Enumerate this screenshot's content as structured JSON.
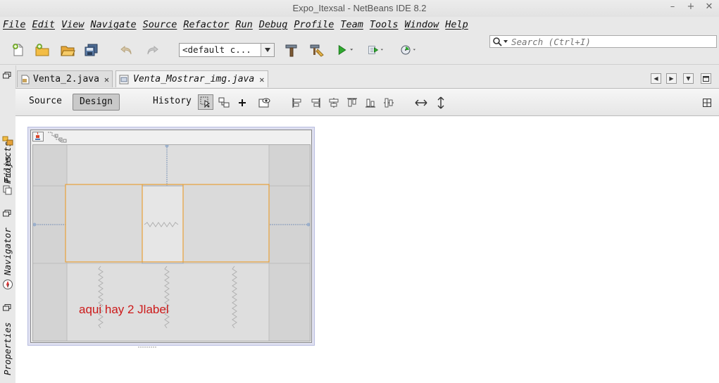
{
  "window": {
    "title": "Expo_Itexsal - NetBeans IDE 8.2",
    "controls": [
      "–",
      "+",
      "✕"
    ]
  },
  "menu": [
    "File",
    "Edit",
    "View",
    "Navigate",
    "Source",
    "Refactor",
    "Run",
    "Debug",
    "Profile",
    "Team",
    "Tools",
    "Window",
    "Help"
  ],
  "search": {
    "placeholder": "Search (Ctrl+I)"
  },
  "toolbar": {
    "config_combo": "<default c...",
    "icons": [
      "new-file-icon",
      "new-project-icon",
      "open-project-icon",
      "save-all-icon",
      "undo-icon",
      "redo-icon",
      "build-hammer-icon",
      "clean-build-icon",
      "run-icon",
      "debug-icon",
      "profile-icon"
    ]
  },
  "side_tabs": [
    "Projects",
    "Files",
    "Navigator",
    "Properties"
  ],
  "file_tabs": [
    {
      "name": "Venta_2.java",
      "active": false
    },
    {
      "name": "Venta_Mostrar_img.java",
      "active": true
    }
  ],
  "editor_views": [
    {
      "label": "Source",
      "selected": false
    },
    {
      "label": "Design",
      "selected": true
    },
    {
      "label": "History",
      "selected": false
    }
  ],
  "design": {
    "annotation": "aqui hay 2 Jlabel"
  },
  "colors": {
    "accent_orange": "#e8a13a",
    "annotation_red": "#cc1a1a",
    "run_green": "#2fa82f"
  }
}
